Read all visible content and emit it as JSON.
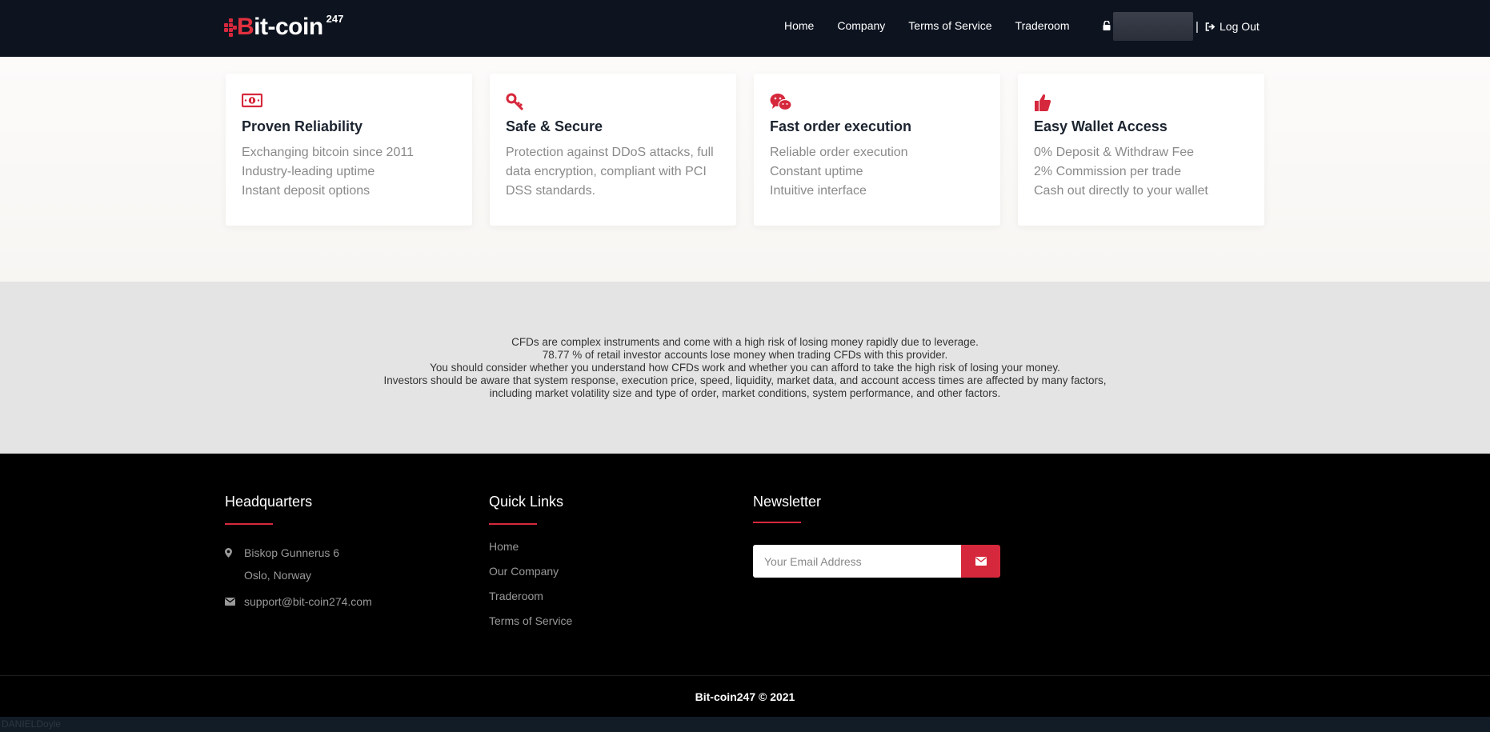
{
  "header": {
    "logo_text_main": "it-coin",
    "logo_text_b": "B",
    "logo_sup": "247",
    "nav": [
      {
        "label": "Home"
      },
      {
        "label": "Company"
      },
      {
        "label": "Terms of Service"
      },
      {
        "label": "Traderoom"
      }
    ],
    "separator": "|",
    "logout_label": "Log Out"
  },
  "features": [
    {
      "icon": "money-icon",
      "title": "Proven Reliability",
      "lines": [
        "Exchanging bitcoin since 2011",
        "Industry-leading uptime",
        "Instant deposit options"
      ]
    },
    {
      "icon": "key-icon",
      "title": "Safe & Secure",
      "lines": [
        "Protection against DDoS attacks, full",
        "data encryption, compliant with PCI",
        "DSS standards."
      ]
    },
    {
      "icon": "wechat-icon",
      "title": "Fast order execution",
      "lines": [
        "Reliable order execution",
        "Constant uptime",
        "Intuitive interface"
      ]
    },
    {
      "icon": "thumbs-up-icon",
      "title": "Easy Wallet Access",
      "lines": [
        "0% Deposit & Withdraw Fee",
        "2% Commission per trade",
        "Cash out directly to your wallet"
      ]
    }
  ],
  "disclaimer": [
    "CFDs are complex instruments and come with a high risk of losing money rapidly due to leverage.",
    "78.77 % of retail investor accounts lose money when trading CFDs with this provider.",
    "You should consider whether you understand how CFDs work and whether you can afford to take the high risk of losing your money.",
    "Investors should be aware that system response, execution price, speed, liquidity, market data, and account access times are affected by many factors,",
    "including market volatility size and type of order, market conditions, system performance, and other factors."
  ],
  "footer": {
    "headquarters": {
      "title": "Headquarters",
      "address_line1": "Biskop Gunnerus 6",
      "address_line2": "Oslo, Norway",
      "email": "support@bit-coin274.com"
    },
    "quick_links": {
      "title": "Quick Links",
      "links": [
        {
          "label": "Home"
        },
        {
          "label": "Our Company"
        },
        {
          "label": "Traderoom"
        },
        {
          "label": "Terms of Service"
        }
      ]
    },
    "newsletter": {
      "title": "Newsletter",
      "placeholder": "Your Email Address"
    },
    "copyright": "Bit-coin247 © 2021"
  },
  "statusbar": {
    "text": "DANIELDoyle"
  },
  "colors": {
    "accent": "#d6283c",
    "nav_bg": "#0d1420",
    "footer_bg": "#000000",
    "disclaimer_bg": "#e4e4e4"
  }
}
